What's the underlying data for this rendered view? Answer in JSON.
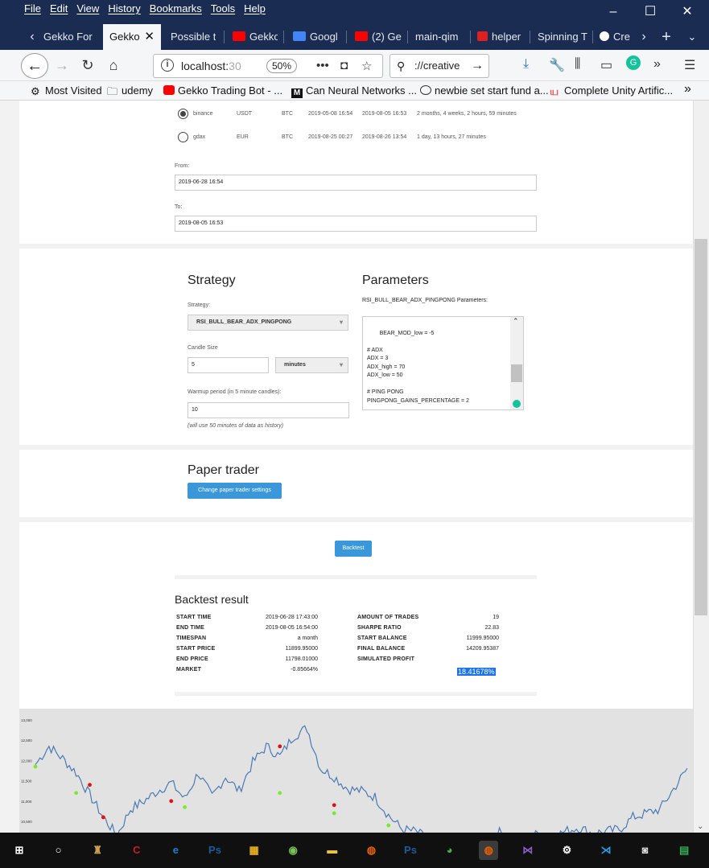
{
  "menu": [
    "File",
    "Edit",
    "View",
    "History",
    "Bookmarks",
    "Tools",
    "Help"
  ],
  "window_controls": {
    "minimize": "–",
    "maximize": "☐",
    "close": "✕"
  },
  "tabs": [
    {
      "label": "Gekko For",
      "active": false,
      "icon_color": "#ffffff"
    },
    {
      "label": "Gekko",
      "active": true,
      "icon_color": ""
    },
    {
      "label": "Possible to",
      "active": false,
      "icon_color": ""
    },
    {
      "label": "Gekko",
      "active": false,
      "icon_color": "#ff0000"
    },
    {
      "label": "Googl",
      "active": false,
      "icon_color": "#4285f4"
    },
    {
      "label": "(2) Gek",
      "active": false,
      "icon_color": "#ff0000"
    },
    {
      "label": "main-qim",
      "active": false,
      "icon_color": ""
    },
    {
      "label": "helper",
      "active": false,
      "icon_color": "#e02020"
    },
    {
      "label": "Spinning T",
      "active": false,
      "icon_color": ""
    },
    {
      "label": "Cre",
      "active": false,
      "icon_color": "#ffffff"
    }
  ],
  "nav": {
    "url_host": "localhost:",
    "url_port": "30",
    "zoom": "50%",
    "search_text": "://creative"
  },
  "bookmarks": [
    {
      "label": "Most Visited",
      "icon": "gear-icon"
    },
    {
      "label": "udemy",
      "icon": "folder-icon"
    },
    {
      "label": "Gekko Trading Bot - ...",
      "icon": "youtube-icon"
    },
    {
      "label": "Can Neural Networks ...",
      "icon": "medium-icon"
    },
    {
      "label": "newbie set start fund a...",
      "icon": "globe-icon"
    },
    {
      "label": "Complete Unity Artific...",
      "icon": "udemy-icon"
    }
  ],
  "datasets": [
    {
      "exchange": "binance",
      "currency": "USDT",
      "asset": "BTC",
      "from": "2019-05-08 16:54",
      "to": "2019-08-05 16:53",
      "duration": "2 months, 4 weeks, 2 hours, 59 minutes",
      "selected": true
    },
    {
      "exchange": "gdax",
      "currency": "EUR",
      "asset": "BTC",
      "from": "2019-08-25 00:27",
      "to": "2019-08-26 13:54",
      "duration": "1 day, 13 hours, 27 minutes",
      "selected": false
    }
  ],
  "range": {
    "from_label": "From:",
    "from_value": "2019-06-28 16:54",
    "to_label": "To:",
    "to_value": "2019-08-05 16:53"
  },
  "strategy": {
    "title": "Strategy",
    "strategy_label": "Strategy:",
    "strategy_value": "RSI_BULL_BEAR_ADX_PINGPONG",
    "candle_label": "Candle Size",
    "candle_value": "5",
    "candle_unit": "minutes",
    "warmup_label": "Warmup period (in 5 minute candles):",
    "warmup_value": "10",
    "warmup_note": "(will use 50 minutes of data as history)"
  },
  "parameters": {
    "title": "Parameters",
    "subtitle": "RSI_BULL_BEAR_ADX_PINGPONG Parameters:",
    "text": "BEAR_MOD_low = -5\n\n# ADX\nADX = 3\nADX_high = 70\nADX_low = 50\n\n# PING PONG\nPINGPONG_GAINS_PERCENTAGE = 2"
  },
  "paper_trader": {
    "title": "Paper trader",
    "button": "Change paper trader settings"
  },
  "backtest_button": "Backtest",
  "result": {
    "title": "Backtest result",
    "left": [
      {
        "k": "START TIME",
        "v": "2019-06-28 17:43:00"
      },
      {
        "k": "END TIME",
        "v": "2019-08-05 16:54:00"
      },
      {
        "k": "TIMESPAN",
        "v": "a month"
      },
      {
        "k": "START PRICE",
        "v": "11899.95000"
      },
      {
        "k": "END PRICE",
        "v": "11798.01000"
      },
      {
        "k": "MARKET",
        "v": "-0.85664%"
      }
    ],
    "right": [
      {
        "k": "AMOUNT OF TRADES",
        "v": "19"
      },
      {
        "k": "SHARPE RATIO",
        "v": "22.83"
      },
      {
        "k": "START BALANCE",
        "v": "11999.95000"
      },
      {
        "k": "FINAL BALANCE",
        "v": "14209.95387"
      },
      {
        "k": "SIMULATED PROFIT",
        "v": ""
      }
    ],
    "profit": "18.41678%"
  },
  "chart_data": {
    "type": "line",
    "title": "",
    "xlabel": "",
    "ylabel": "",
    "ylim": [
      10000,
      13000
    ],
    "y_ticks": [
      "13,000",
      "12,500",
      "12,000",
      "11,500",
      "11,000",
      "10,500",
      "10,000"
    ],
    "series": [
      {
        "values": [
          11900,
          12350,
          12050,
          11700,
          11150,
          10600,
          10150,
          10800,
          11000,
          11250,
          11450,
          11050,
          11700,
          11100,
          11600,
          11250,
          11950,
          12350,
          12100,
          12600,
          12800,
          11800,
          11600,
          11300,
          11250,
          11100,
          10650,
          10300,
          10250,
          10050,
          9950,
          9800,
          9800,
          10100,
          10250,
          10100,
          10000,
          10200,
          10100,
          10250,
          10350,
          10200,
          10250,
          10300,
          10600,
          10700,
          10800,
          11300,
          11800
        ]
      }
    ],
    "buy_markers": [
      [
        0,
        11850
      ],
      [
        3,
        11200
      ],
      [
        11,
        10850
      ],
      [
        18,
        11200
      ],
      [
        22,
        10700
      ],
      [
        26,
        10400
      ]
    ],
    "sell_markers": [
      [
        4,
        11400
      ],
      [
        5,
        10600
      ],
      [
        10,
        11000
      ],
      [
        18,
        12350
      ],
      [
        22,
        10900
      ],
      [
        26,
        10050
      ],
      [
        34,
        10100
      ]
    ],
    "line_color": "#4a7ab5",
    "buy_color": "#7bea2e",
    "sell_color": "#e01010"
  },
  "taskbar": [
    {
      "icon": "windows-start-icon",
      "color": "#ffffff"
    },
    {
      "icon": "cortana-icon",
      "color": "#ffffff"
    },
    {
      "icon": "rocket-app-icon",
      "color": "#c8a050"
    },
    {
      "icon": "red-app-icon",
      "color": "#c32020"
    },
    {
      "icon": "edge-icon",
      "color": "#1f7ed0"
    },
    {
      "icon": "photoshop-icon",
      "color": "#1e5a9e"
    },
    {
      "icon": "yellow-app-icon",
      "color": "#e8b21a"
    },
    {
      "icon": "android-studio-icon",
      "color": "#78c257"
    },
    {
      "icon": "file-explorer-icon",
      "color": "#f1c232"
    },
    {
      "icon": "firefox-icon",
      "color": "#e66000"
    },
    {
      "icon": "photoshop-icon-2",
      "color": "#1e5a9e"
    },
    {
      "icon": "chrome-icon",
      "color": "#4caf50"
    },
    {
      "icon": "firefox-active-icon",
      "color": "#e66000"
    },
    {
      "icon": "visual-studio-icon",
      "color": "#8661c5"
    },
    {
      "icon": "settings-icon",
      "color": "#ffffff"
    },
    {
      "icon": "vscode-icon",
      "color": "#2a9be6"
    },
    {
      "icon": "media-app-icon",
      "color": "#dddddd"
    },
    {
      "icon": "sheets-icon",
      "color": "#34a853"
    }
  ]
}
